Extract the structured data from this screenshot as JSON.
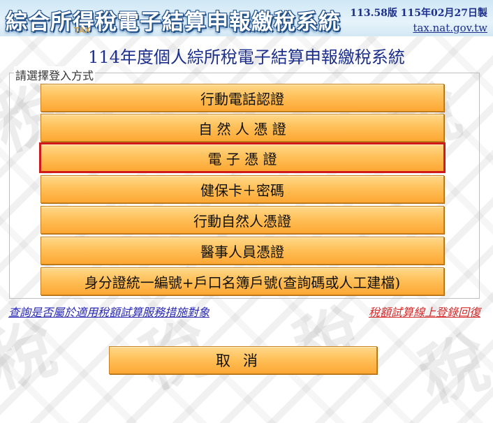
{
  "banner": {
    "title": "綜合所得稅電子結算申報繳稅系統",
    "tax_mark": "TAX",
    "version": "113.58版  115年02月27日製",
    "site": "tax.nat.gov.tw"
  },
  "page_title": "114年度個人綜所稅電子結算申報繳稅系統",
  "login": {
    "legend": "請選擇登入方式",
    "options": [
      {
        "label": "行動電話認證"
      },
      {
        "label": "自 然 人 憑 證"
      },
      {
        "label": "電 子 憑 證",
        "selected": true
      },
      {
        "label": "健保卡＋密碼"
      },
      {
        "label": "行動自然人憑證"
      },
      {
        "label": "醫事人員憑證"
      },
      {
        "label": "身分證統一編號+戶口名簿戶號(查詢碼或人工建檔)"
      }
    ]
  },
  "links": {
    "left": "查詢是否屬於適用稅額試算服務措施對象",
    "right": "稅額試算線上登錄回復"
  },
  "cancel_label": "取消",
  "colors": {
    "button_orange": "#fdb13c",
    "selected_outline": "#d21919",
    "title_blue": "#1d2f8c",
    "link_blue": "#2a2ab5",
    "link_red": "#d42a2a"
  }
}
